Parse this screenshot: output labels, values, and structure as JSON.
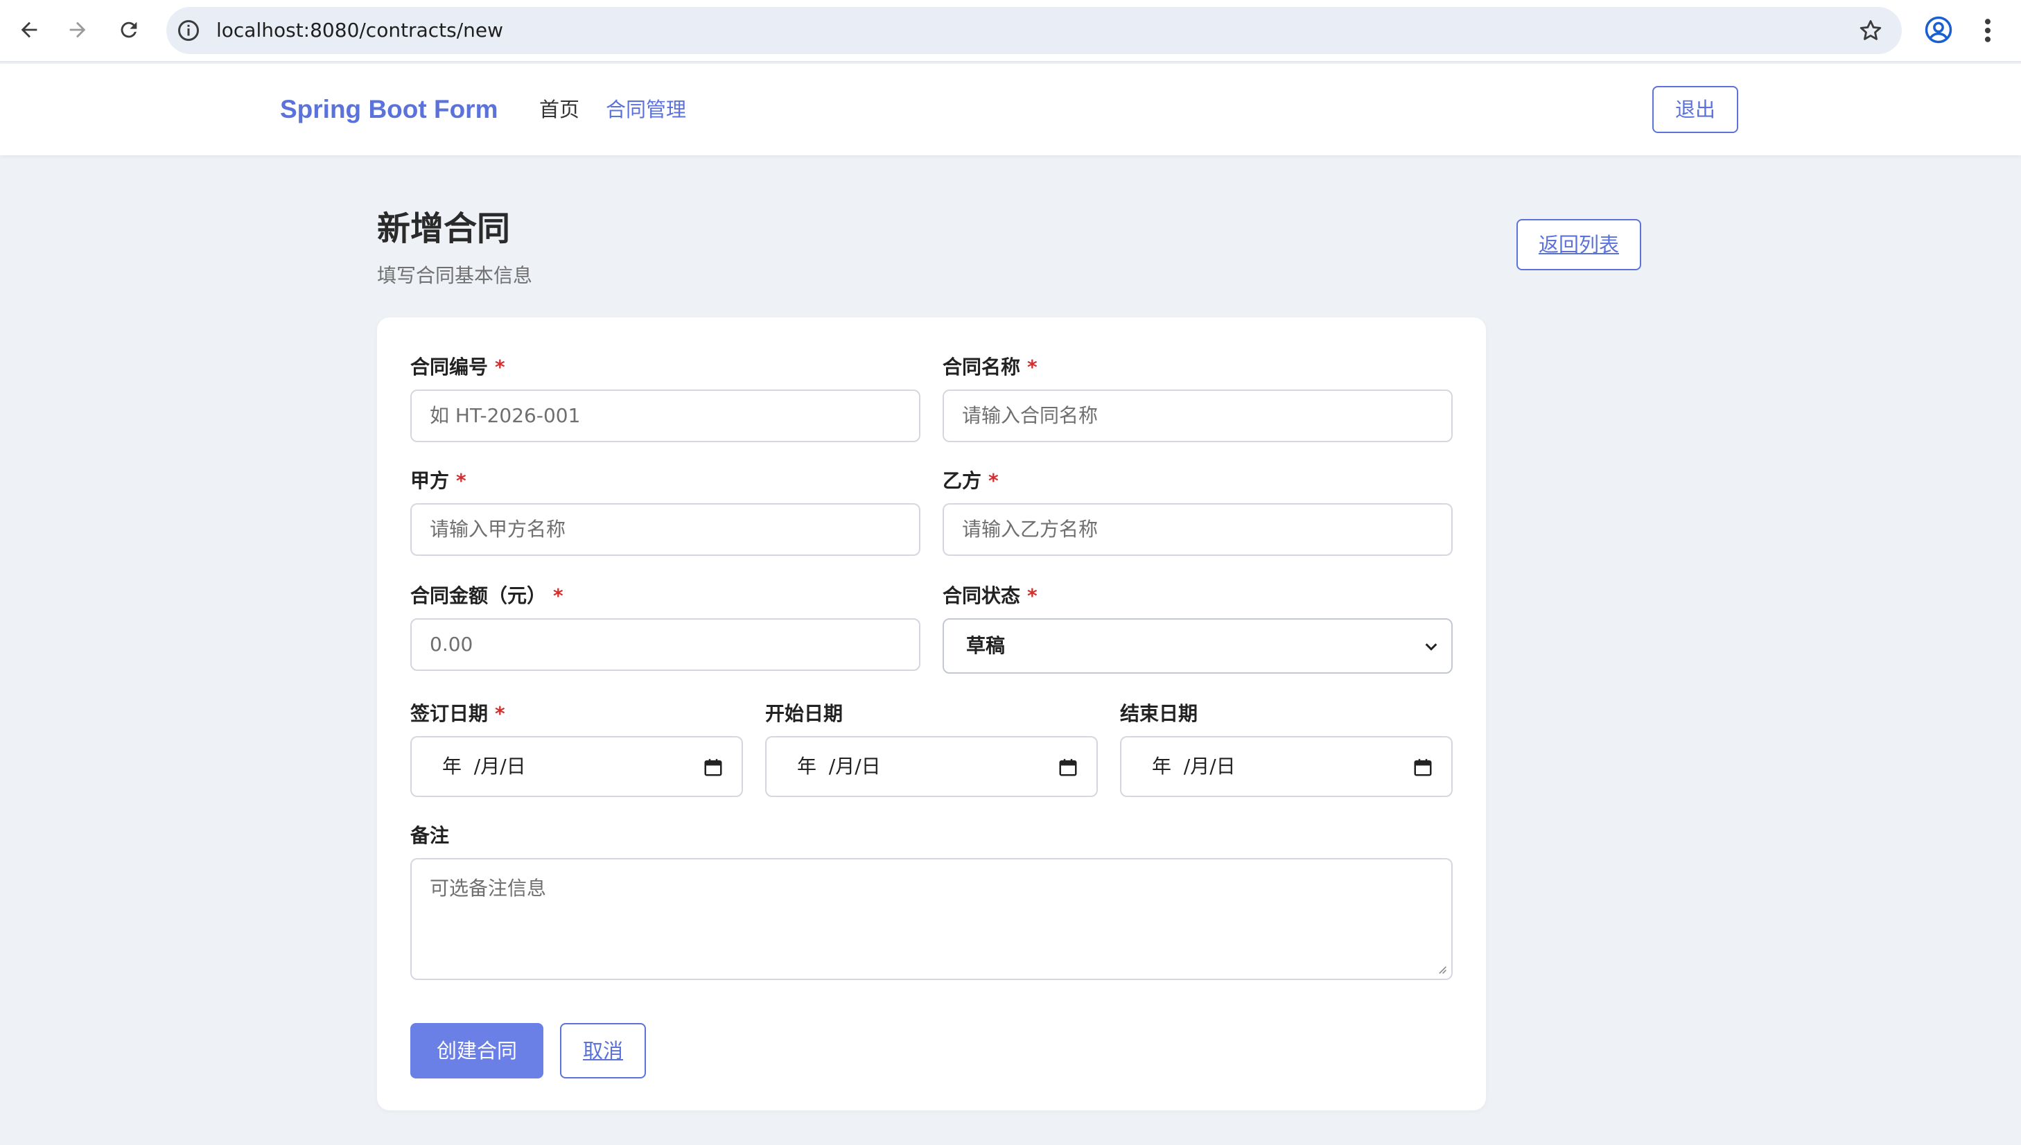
{
  "browser": {
    "url": "localhost:8080/contracts/new"
  },
  "navbar": {
    "brand": "Spring Boot Form",
    "links": [
      "首页",
      "合同管理"
    ],
    "active_link": "合同管理",
    "logout_label": "退出"
  },
  "page": {
    "title": "新增合同",
    "subtitle": "填写合同基本信息",
    "back_label": "返回列表"
  },
  "form": {
    "required_mark": "*",
    "contract_no": {
      "label": "合同编号",
      "placeholder": "如 HT-2026-001"
    },
    "contract_name": {
      "label": "合同名称",
      "placeholder": "请输入合同名称"
    },
    "party_a": {
      "label": "甲方",
      "placeholder": "请输入甲方名称"
    },
    "party_b": {
      "label": "乙方",
      "placeholder": "请输入乙方名称"
    },
    "amount": {
      "label": "合同金额（元）",
      "placeholder": "0.00"
    },
    "status": {
      "label": "合同状态",
      "value": "草稿"
    },
    "sign_date": {
      "label": "签订日期",
      "value": "年  /月/日"
    },
    "start_date": {
      "label": "开始日期",
      "value": "年  /月/日"
    },
    "end_date": {
      "label": "结束日期",
      "value": "年  /月/日"
    },
    "remark": {
      "label": "备注",
      "placeholder": "可选备注信息"
    },
    "submit_label": "创建合同",
    "cancel_label": "取消"
  },
  "colors": {
    "accent": "#5b72db",
    "primary_button": "#6a80e6",
    "required": "#d32f2f",
    "page_bg": "#eef1f6"
  }
}
